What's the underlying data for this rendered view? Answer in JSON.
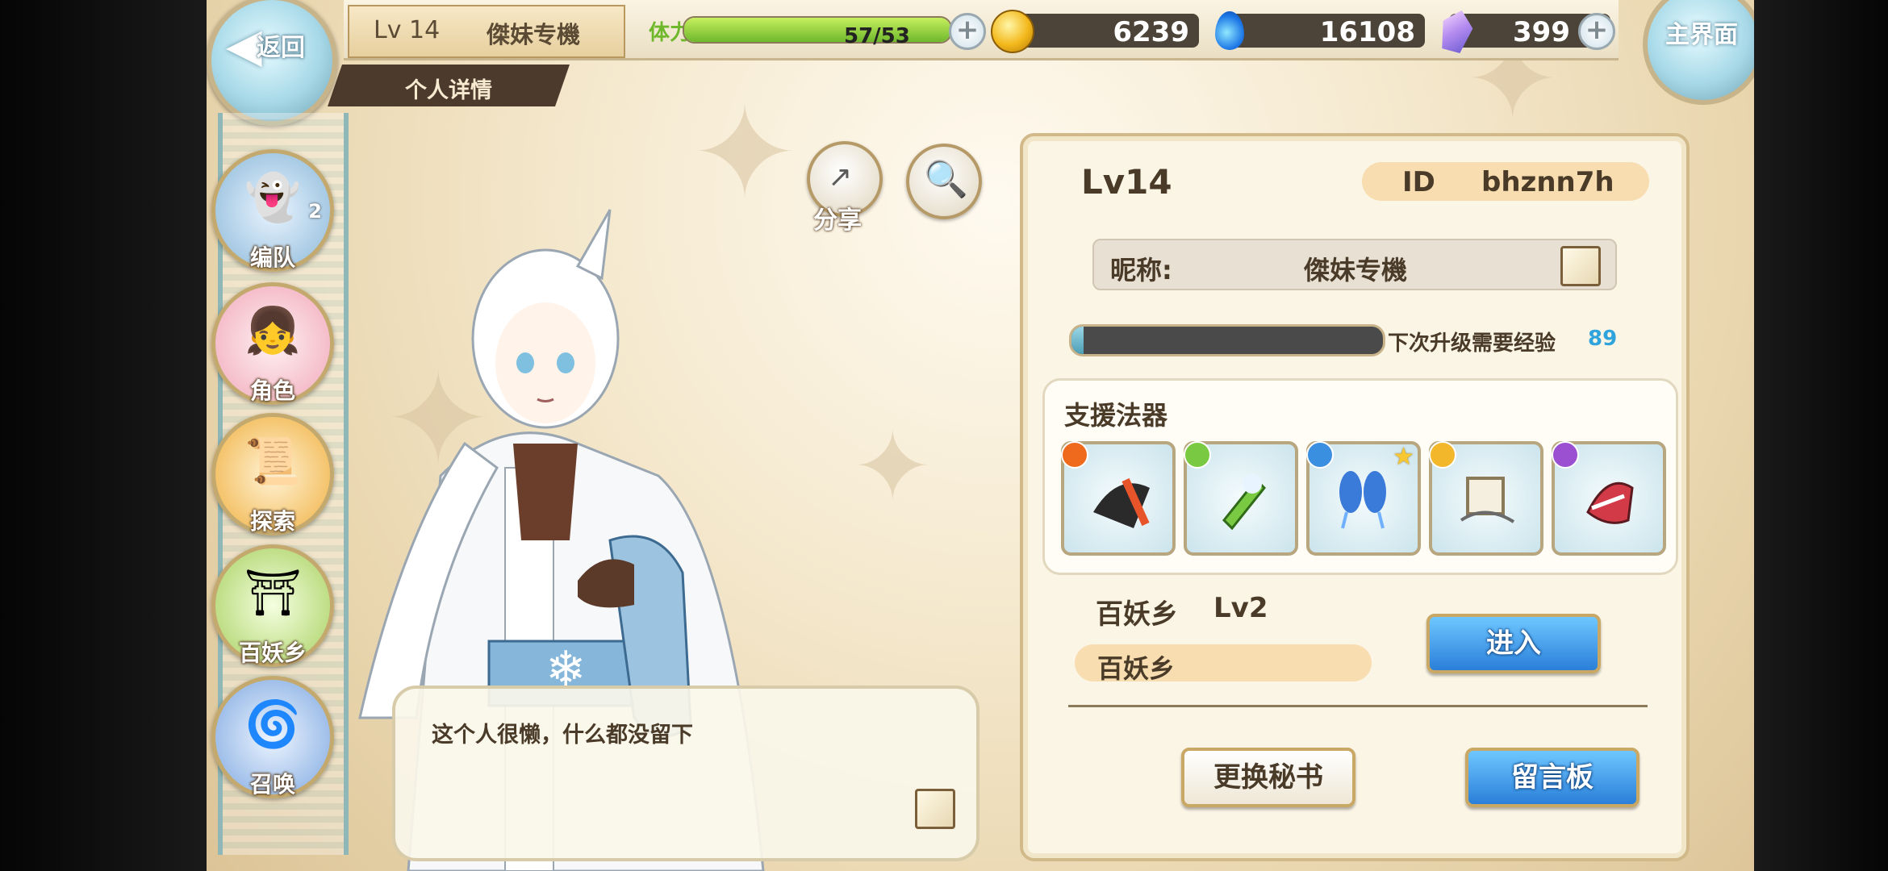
{
  "header": {
    "back_label": "返回",
    "level": "Lv 14",
    "nickname": "傑妹专機",
    "page_title": "个人详情",
    "stamina_label": "体力",
    "stamina_value": "57/53",
    "stamina_fraction": 1.0,
    "gold": "6239",
    "soul": "16108",
    "crystal": "399",
    "home_label": "主界面"
  },
  "side_menu": [
    {
      "label": "编队",
      "icon": "formation-icon",
      "badge": "2"
    },
    {
      "label": "角色",
      "icon": "character-icon"
    },
    {
      "label": "探索",
      "icon": "explore-icon"
    },
    {
      "label": "百妖乡",
      "icon": "village-icon"
    },
    {
      "label": "召唤",
      "icon": "summon-icon"
    }
  ],
  "actions": {
    "share_label": "分享",
    "search_icon": "magnifier-icon"
  },
  "dialog": {
    "text": "这个人很懒，什么都没留下"
  },
  "profile": {
    "level": "Lv14",
    "id_label": "ID",
    "id_value": "bhznn7h",
    "nickname_label": "昵称:",
    "nickname_value": "傑妹专機",
    "exp_label": "下次升级需要经验",
    "exp_value": "89",
    "exp_fraction": 0.02,
    "support_title": "支援法器",
    "support_items": [
      {
        "element": "fire",
        "color": "#f06a1e",
        "star": false
      },
      {
        "element": "wind",
        "color": "#7ac943",
        "star": false
      },
      {
        "element": "water",
        "color": "#3a8fe0",
        "star": true
      },
      {
        "element": "light",
        "color": "#f2b72a",
        "star": false
      },
      {
        "element": "dark",
        "color": "#9b4fd1",
        "star": false
      }
    ],
    "village_title": "百妖乡",
    "village_level": "Lv2",
    "village_name": "百妖乡",
    "enter_button": "进入",
    "secretary_button": "更换秘书",
    "board_button": "留言板"
  }
}
